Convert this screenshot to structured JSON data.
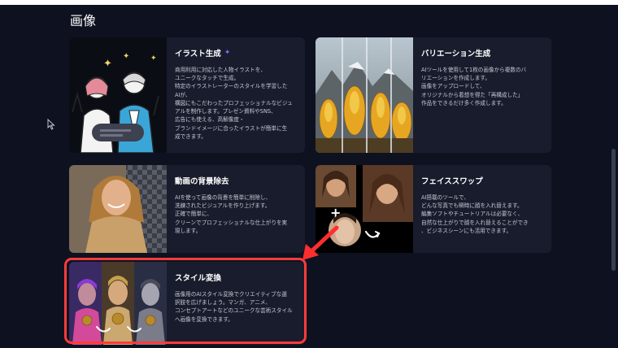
{
  "section": {
    "title": "画像"
  },
  "cards": [
    {
      "title": "イラスト生成",
      "badge_icon": "sparkle-icon",
      "description": "商用利用に対応した人物イラストを、\nユニークなタッチで生成。\n特定のイラストレーターのスタイルを学習した\nAIが、\n構図にもこだわったプロフェッショナルなビジュ\nアルを制作します。プレゼン資料やSNS、\n広告にも使える、高解像度・\nブランドイメージに合ったイラストが簡単に生\n成できます。"
    },
    {
      "title": "バリエーション生成",
      "description": "AIツールを使用して1枚の画像から複数のバ\nリエーションを作成します。\n画像をアップロードして、\nオリジナルから着想を得た「再構成した」\n作品をできるだけ多く作成します。"
    },
    {
      "title": "動画の背景除去",
      "description": "AIを使って画像の背景を簡単に削除し、\n洗練されたビジュアルを作り上げます。\n正確で簡単に、\nクリーンでプロフェッショナルな仕上がりを実\n現します。"
    },
    {
      "title": "フェイススワップ",
      "description": "AI搭載のツールで、\nどんな写真でも瞬時に顔を入れ替えます。\n編集ソフトやチュートリアルは必要なく、\n自然な仕上がりで顔を入れ替えることができ\n、ビジネスシーンにも活用できます。"
    },
    {
      "title": "スタイル変換",
      "description": "画像用のAIスタイル変換でクリエイティブな選\n択肢を広げましょう。マンガ、アニメ、\nコンセプトアートなどのユニークな芸術スタイル\nへ画像を変換できます。"
    }
  ],
  "colors": {
    "background": "#0e1220",
    "card": "#181c2c",
    "highlight": "#ff3b3b",
    "accent": "#7b6cff"
  }
}
